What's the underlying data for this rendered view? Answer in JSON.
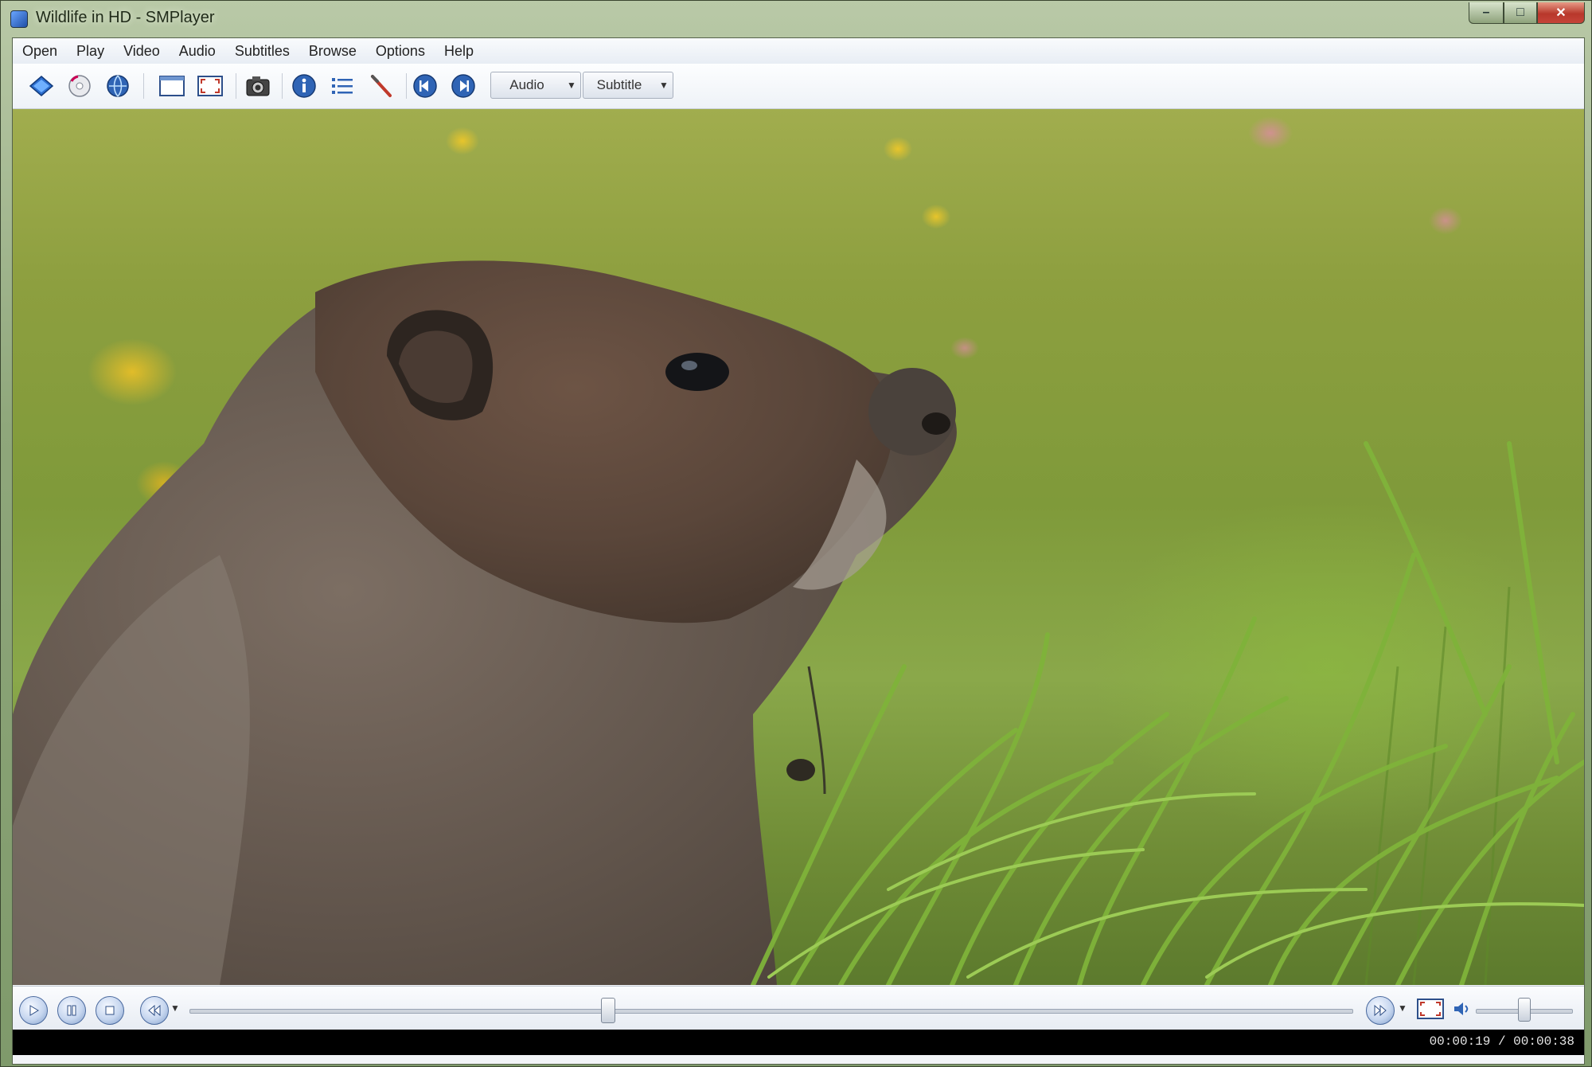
{
  "window": {
    "title": "Wildlife in HD - SMPlayer",
    "controls": {
      "minimize": "–",
      "maximize": "□",
      "close": "✕"
    }
  },
  "menubar": {
    "items": [
      {
        "label": "Open"
      },
      {
        "label": "Play"
      },
      {
        "label": "Video"
      },
      {
        "label": "Audio"
      },
      {
        "label": "Subtitles"
      },
      {
        "label": "Browse"
      },
      {
        "label": "Options"
      },
      {
        "label": "Help"
      }
    ]
  },
  "toolbar": {
    "buttons": [
      {
        "icon": "open-file-icon"
      },
      {
        "icon": "open-dvd-icon"
      },
      {
        "icon": "open-url-icon"
      },
      {
        "icon": "compact-mode-icon"
      },
      {
        "icon": "fullscreen-icon"
      },
      {
        "icon": "screenshot-icon"
      },
      {
        "icon": "info-icon"
      },
      {
        "icon": "playlist-icon"
      },
      {
        "icon": "preferences-icon"
      },
      {
        "icon": "previous-icon"
      },
      {
        "icon": "next-icon"
      }
    ],
    "audio_combo": "Audio",
    "subtitle_combo": "Subtitle"
  },
  "video": {
    "description_icon": "video-frame"
  },
  "controlbar": {
    "play_icon": "play-icon",
    "pause_icon": "pause-icon",
    "stop_icon": "stop-icon",
    "rewind_icon": "rewind-icon",
    "forward_icon": "forward-icon",
    "fullscreen_icon": "fullscreen-icon",
    "mute_icon": "speaker-icon",
    "seek_progress": 0.36,
    "volume_level": 0.5
  },
  "statusbar": {
    "time": "00:00:19 / 00:00:38"
  },
  "colors": {
    "accent": "#2f64b5",
    "status_bg": "#000000"
  }
}
